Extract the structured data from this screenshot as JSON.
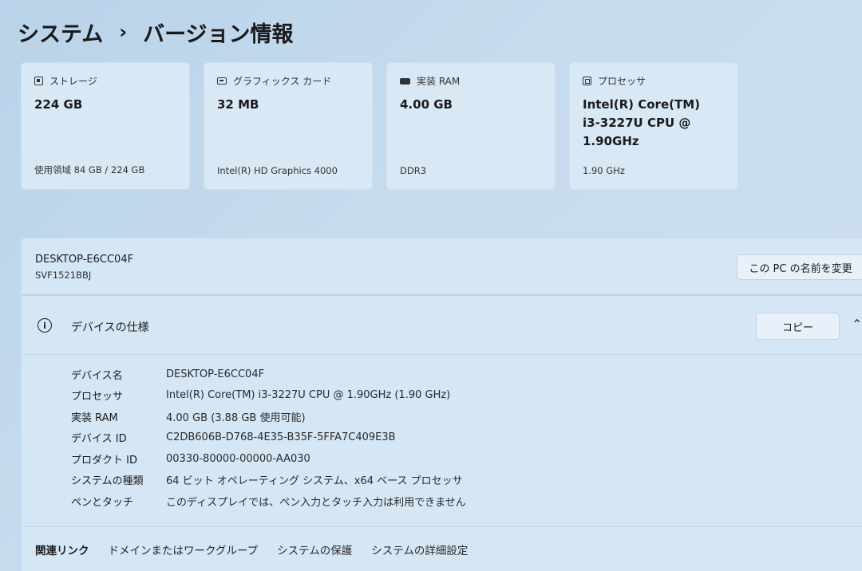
{
  "breadcrumb": {
    "parent": "システム",
    "separator": "›",
    "current": "バージョン情報"
  },
  "cards": [
    {
      "title": "ストレージ",
      "value": "224 GB",
      "sub": "使用領域 84 GB / 224 GB",
      "icon": "storage-icon"
    },
    {
      "title": "グラフィックス カード",
      "value": "32 MB",
      "sub": "Intel(R) HD Graphics 4000",
      "icon": "gpu-icon"
    },
    {
      "title": "実装 RAM",
      "value": "4.00 GB",
      "sub": "DDR3",
      "icon": "ram-icon"
    },
    {
      "title": "プロセッサ",
      "value": "Intel(R) Core(TM) i3-3227U CPU @ 1.90GHz",
      "sub": "1.90 GHz",
      "icon": "cpu-icon"
    }
  ],
  "pc": {
    "name": "DESKTOP-E6CC04F",
    "model": "SVF1521BBJ",
    "rename_label": "この PC の名前を変更"
  },
  "specs": {
    "title": "デバイスの仕様",
    "copy_label": "コピー",
    "rows": [
      {
        "label": "デバイス名",
        "value": "DESKTOP-E6CC04F"
      },
      {
        "label": "プロセッサ",
        "value": "Intel(R) Core(TM) i3-3227U CPU @ 1.90GHz (1.90 GHz)"
      },
      {
        "label": "実装 RAM",
        "value": "4.00 GB (3.88 GB 使用可能)"
      },
      {
        "label": "デバイス ID",
        "value": "C2DB606B-D768-4E35-B35F-5FFA7C409E3B"
      },
      {
        "label": "プロダクト ID",
        "value": "00330-80000-00000-AA030"
      },
      {
        "label": "システムの種類",
        "value": "64 ビット オペレーティング システム、x64 ベース プロセッサ"
      },
      {
        "label": "ペンとタッチ",
        "value": "このディスプレイでは、ペン入力とタッチ入力は利用できません"
      }
    ]
  },
  "related": {
    "label": "関連リンク",
    "links": [
      "ドメインまたはワークグループ",
      "システムの保護",
      "システムの詳細設定"
    ]
  }
}
